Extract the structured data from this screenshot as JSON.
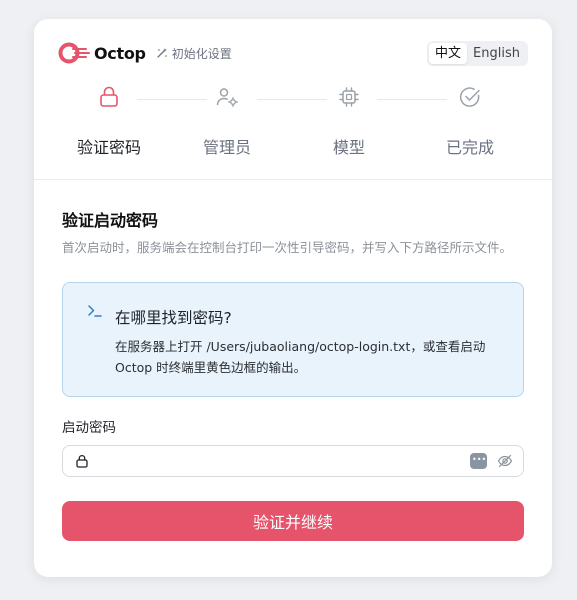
{
  "brand": {
    "name": "Octop",
    "subtitle": "初始化设置"
  },
  "language": {
    "options": [
      "中文",
      "English"
    ],
    "active": "中文"
  },
  "steps": [
    {
      "label": "验证密码",
      "icon": "lock-icon",
      "state": "active"
    },
    {
      "label": "管理员",
      "icon": "user-settings-icon",
      "state": "pending"
    },
    {
      "label": "模型",
      "icon": "chip-icon",
      "state": "pending"
    },
    {
      "label": "已完成",
      "icon": "check-circle-icon",
      "state": "pending"
    }
  ],
  "section": {
    "title": "验证启动密码",
    "description": "首次启动时，服务端会在控制台打印一次性引导密码，并写入下方路径所示文件。"
  },
  "info": {
    "title": "在哪里找到密码?",
    "text": "在服务器上打开 /Users/jubaoliang/octop-login.txt，或查看启动 Octop 时终端里黄色边框的输出。"
  },
  "field": {
    "label": "启动密码",
    "value": "",
    "placeholder": ""
  },
  "submit": {
    "label": "验证并继续"
  },
  "colors": {
    "accent": "#e5546b",
    "active_step": "#e5546b",
    "info_bg": "#e8f3fc",
    "info_border": "#b5d5ee"
  }
}
